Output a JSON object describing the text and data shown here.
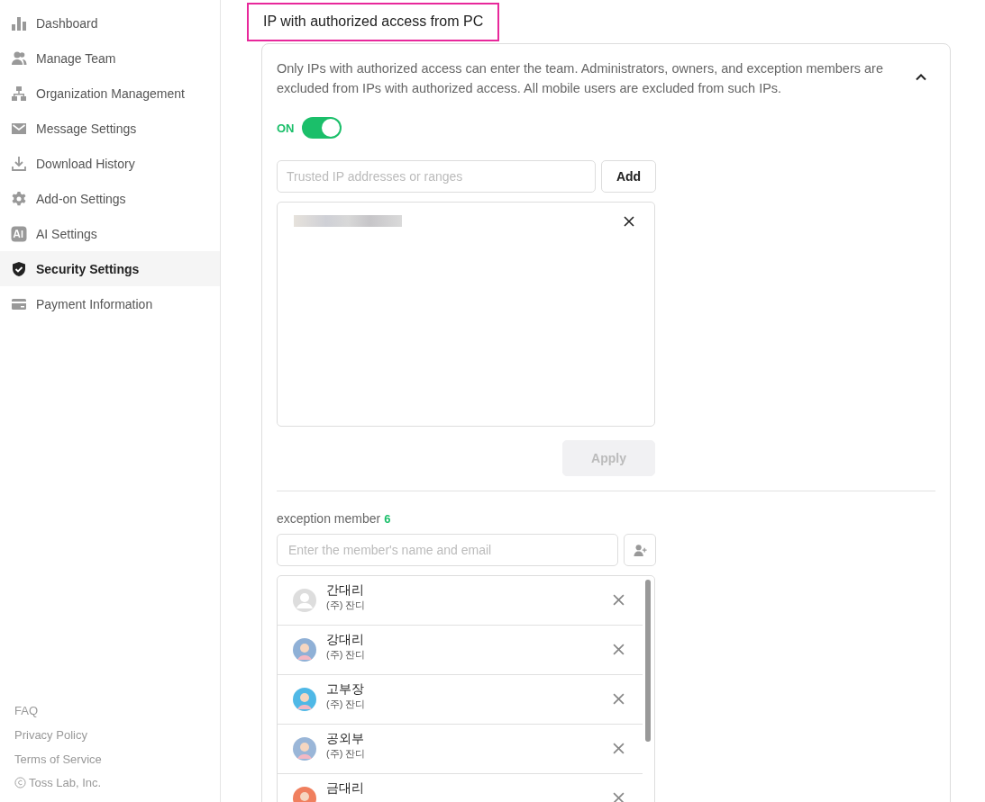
{
  "sidebar": {
    "items": [
      {
        "label": "Dashboard",
        "kind": "chart",
        "selected": false
      },
      {
        "label": "Manage Team",
        "kind": "people",
        "selected": false
      },
      {
        "label": "Organization Management",
        "kind": "org",
        "selected": false
      },
      {
        "label": "Message Settings",
        "kind": "mail",
        "selected": false
      },
      {
        "label": "Download History",
        "kind": "download",
        "selected": false
      },
      {
        "label": "Add-on Settings",
        "kind": "gear",
        "selected": false
      },
      {
        "label": "AI Settings",
        "kind": "ai",
        "selected": false
      },
      {
        "label": "Security Settings",
        "kind": "shield",
        "selected": true
      },
      {
        "label": "Payment Information",
        "kind": "card",
        "selected": false
      }
    ],
    "footer_links": [
      "FAQ",
      "Privacy Policy",
      "Terms of Service"
    ],
    "copyright": "Toss Lab, Inc."
  },
  "section": {
    "title": "IP with authorized access from PC",
    "highlighted": true,
    "description": "Only IPs with authorized access can enter the team. Administrators, owners, and exception members are excluded from IPs with authorized access. All mobile users are excluded from such IPs.",
    "expanded": true,
    "toggle": {
      "label": "ON",
      "on": true
    },
    "ip_input": {
      "placeholder": "Trusted IP addresses or ranges"
    },
    "add_button": "Add",
    "ip_entries": [
      {
        "blurred": true
      }
    ],
    "apply_button": {
      "label": "Apply",
      "disabled": true
    },
    "exception": {
      "label": "exception member",
      "count": "6",
      "search": {
        "placeholder": "Enter the member's name and email"
      },
      "members": [
        {
          "name": "간대리",
          "org": "(주) 잔디",
          "kind": "placeholder",
          "color": "#dddddd"
        },
        {
          "name": "강대리",
          "org": "(주) 잔디",
          "kind": "person",
          "color": "#8fb0d6"
        },
        {
          "name": "고부장",
          "org": "(주) 잔디",
          "kind": "person",
          "color": "#4fb8e6"
        },
        {
          "name": "공외부",
          "org": "(주) 잔디",
          "kind": "person",
          "color": "#9ab6d8"
        },
        {
          "name": "금대리",
          "kind": "person",
          "color": "#f07f5e"
        }
      ]
    }
  }
}
